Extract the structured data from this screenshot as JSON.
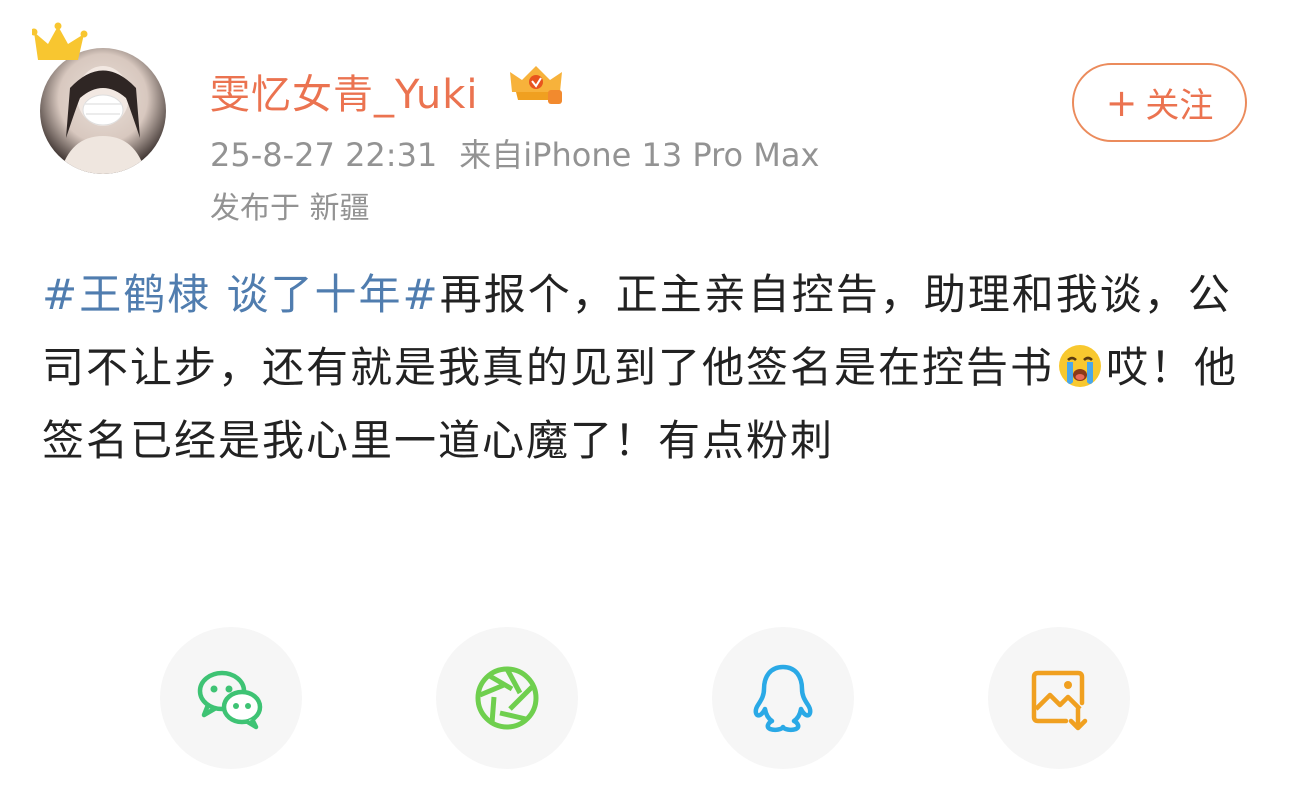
{
  "user": {
    "name": "雯忆女青_Yuki",
    "avatar": "avatar-photo",
    "crown_icon": "crown-icon",
    "badge_icon": "vip-crown-badge-icon"
  },
  "meta": {
    "timestamp": "25-8-27 22:31",
    "source": "来自iPhone 13 Pro Max",
    "location": "发布于 新疆"
  },
  "follow_button": {
    "icon": "plus-icon",
    "label": "关注"
  },
  "post": {
    "hashtag": "#王鹤棣 谈了十年#",
    "text_part1": "再报个，正主亲自控告，助理和我谈，公司不让步，还有就是我真的见到了他签名是在控告书",
    "emoji": "crying-emoji",
    "text_part2": "哎！他签名已经是我心里一道心魔了！有点粉刺"
  },
  "share": {
    "buttons": [
      {
        "icon": "wechat-icon",
        "color": "#3ec374"
      },
      {
        "icon": "moments-icon",
        "color": "#6fcf4e"
      },
      {
        "icon": "qq-icon",
        "color": "#2aa9e6"
      },
      {
        "icon": "save-image-icon",
        "color": "#f0a020"
      }
    ]
  },
  "colors": {
    "username": "#eb7350",
    "hashtag": "#507daf",
    "meta": "#939393",
    "text": "#222222"
  }
}
